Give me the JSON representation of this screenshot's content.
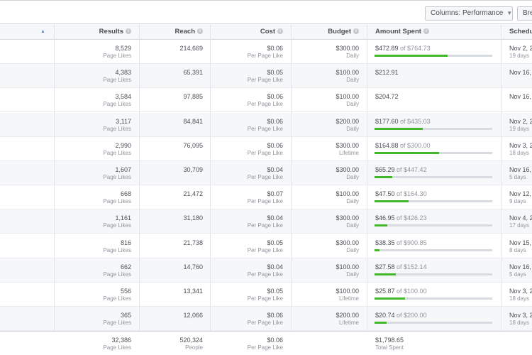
{
  "toolbar": {
    "columns_label": "Columns: Performance",
    "breakdown_label": "Bre"
  },
  "columns": {
    "results": "Results",
    "reach": "Reach",
    "cost": "Cost",
    "budget": "Budget",
    "amount_spent": "Amount Spent",
    "schedule": "Schedul"
  },
  "rows": [
    {
      "results": "8,529",
      "results_sub": "Page Likes",
      "reach": "214,669",
      "cost": "$0.06",
      "cost_sub": "Per Page Like",
      "budget": "$300.00",
      "budget_sub": "Daily",
      "spent": "$472.89",
      "spent_of": " of $764.73",
      "spent_fraction": 0.62,
      "sched": "Nov 2, 2",
      "sched_sub": "19 days"
    },
    {
      "results": "4,383",
      "results_sub": "Page Likes",
      "reach": "65,391",
      "cost": "$0.05",
      "cost_sub": "Per Page Like",
      "budget": "$100.00",
      "budget_sub": "Daily",
      "spent": "$212.91",
      "spent_of": "",
      "spent_fraction": null,
      "sched": "Nov 16,",
      "sched_sub": ""
    },
    {
      "results": "3,584",
      "results_sub": "Page Likes",
      "reach": "97,885",
      "cost": "$0.06",
      "cost_sub": "Per Page Like",
      "budget": "$100.00",
      "budget_sub": "Daily",
      "spent": "$204.72",
      "spent_of": "",
      "spent_fraction": null,
      "sched": "Nov 16,",
      "sched_sub": ""
    },
    {
      "results": "3,117",
      "results_sub": "Page Likes",
      "reach": "84,841",
      "cost": "$0.06",
      "cost_sub": "Per Page Like",
      "budget": "$200.00",
      "budget_sub": "Daily",
      "spent": "$177.60",
      "spent_of": " of $435.03",
      "spent_fraction": 0.41,
      "sched": "Nov 2, 2",
      "sched_sub": "19 days"
    },
    {
      "results": "2,990",
      "results_sub": "Page Likes",
      "reach": "76,095",
      "cost": "$0.06",
      "cost_sub": "Per Page Like",
      "budget": "$300.00",
      "budget_sub": "Lifetime",
      "spent": "$164.88",
      "spent_of": " of $300.00",
      "spent_fraction": 0.55,
      "sched": "Nov 3, 2",
      "sched_sub": "18 days"
    },
    {
      "results": "1,607",
      "results_sub": "Page Likes",
      "reach": "30,709",
      "cost": "$0.04",
      "cost_sub": "Per Page Like",
      "budget": "$300.00",
      "budget_sub": "Daily",
      "spent": "$65.29",
      "spent_of": " of $447.42",
      "spent_fraction": 0.15,
      "sched": "Nov 16,",
      "sched_sub": "5 days"
    },
    {
      "results": "668",
      "results_sub": "Page Likes",
      "reach": "21,472",
      "cost": "$0.07",
      "cost_sub": "Per Page Like",
      "budget": "$100.00",
      "budget_sub": "Daily",
      "spent": "$47.50",
      "spent_of": " of $164.30",
      "spent_fraction": 0.29,
      "sched": "Nov 12,",
      "sched_sub": "9 days"
    },
    {
      "results": "1,161",
      "results_sub": "Page Likes",
      "reach": "31,180",
      "cost": "$0.04",
      "cost_sub": "Per Page Like",
      "budget": "$300.00",
      "budget_sub": "Daily",
      "spent": "$46.95",
      "spent_of": " of $426.23",
      "spent_fraction": 0.11,
      "sched": "Nov 4, 2",
      "sched_sub": "17 days"
    },
    {
      "results": "816",
      "results_sub": "Page Likes",
      "reach": "21,738",
      "cost": "$0.05",
      "cost_sub": "Per Page Like",
      "budget": "$300.00",
      "budget_sub": "Daily",
      "spent": "$38.35",
      "spent_of": " of $900.85",
      "spent_fraction": 0.04,
      "sched": "Nov 15,",
      "sched_sub": "8 days"
    },
    {
      "results": "662",
      "results_sub": "Page Likes",
      "reach": "14,760",
      "cost": "$0.04",
      "cost_sub": "Per Page Like",
      "budget": "$100.00",
      "budget_sub": "Daily",
      "spent": "$27.58",
      "spent_of": " of $152.14",
      "spent_fraction": 0.18,
      "sched": "Nov 16,",
      "sched_sub": "5 days"
    },
    {
      "results": "556",
      "results_sub": "Page Likes",
      "reach": "13,341",
      "cost": "$0.05",
      "cost_sub": "Per Page Like",
      "budget": "$100.00",
      "budget_sub": "Lifetime",
      "spent": "$25.87",
      "spent_of": " of $100.00",
      "spent_fraction": 0.26,
      "sched": "Nov 3, 2",
      "sched_sub": "18 days"
    },
    {
      "results": "365",
      "results_sub": "Page Likes",
      "reach": "12,066",
      "cost": "$0.06",
      "cost_sub": "Per Page Like",
      "budget": "$200.00",
      "budget_sub": "Lifetime",
      "spent": "$20.74",
      "spent_of": " of $200.00",
      "spent_fraction": 0.1,
      "sched": "Nov 3, 2",
      "sched_sub": "18 days"
    }
  ],
  "totals": {
    "results": "32,386",
    "results_sub": "Page Likes",
    "reach": "520,324",
    "reach_sub": "People",
    "cost": "$0.06",
    "cost_sub": "Per Page Like",
    "spent": "$1,798.65",
    "spent_sub": "Total Spent"
  },
  "colors": {
    "progress_fill": "#42b72a",
    "progress_track": "#d8dbe0",
    "header_bg": "#f6f7f9"
  }
}
